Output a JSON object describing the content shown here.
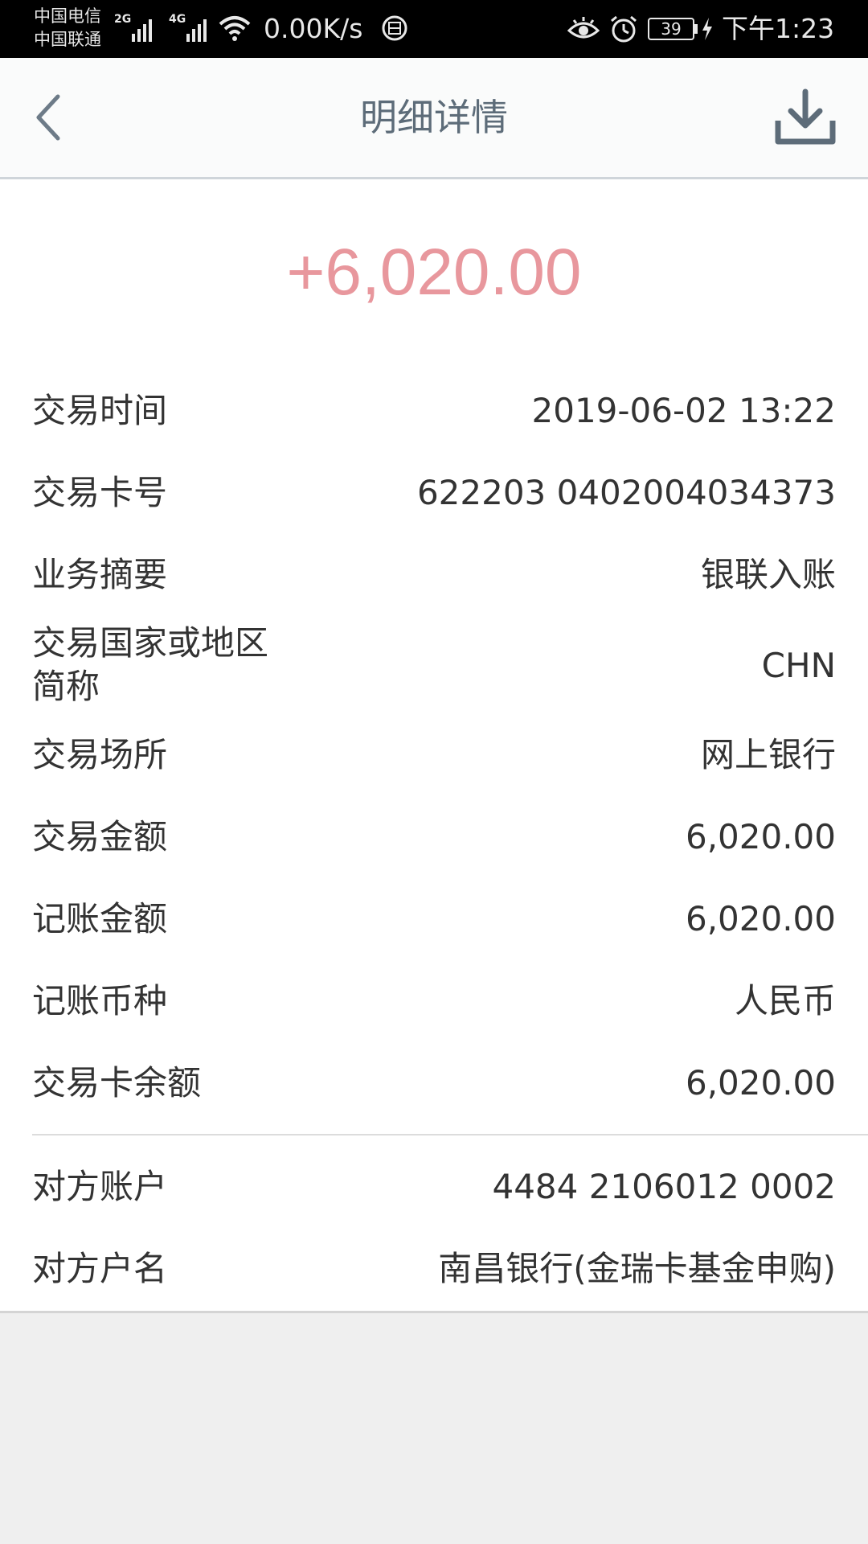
{
  "status_bar": {
    "carrier1": "中国电信",
    "carrier2": "中国联通",
    "net1": "2G",
    "net2": "4G",
    "speed": "0.00K/s",
    "battery": "39",
    "time": "下午1:23"
  },
  "header": {
    "title": "明细详情"
  },
  "detail": {
    "amount": "+6,020.00",
    "rows": [
      {
        "label": "交易时间",
        "value": "2019-06-02 13:22"
      },
      {
        "label": "交易卡号",
        "value": "622203 0402004034373"
      },
      {
        "label": "业务摘要",
        "value": "银联入账"
      },
      {
        "label": "交易国家或地区简称",
        "value": "CHN"
      },
      {
        "label": "交易场所",
        "value": "网上银行"
      },
      {
        "label": "交易金额",
        "value": "6,020.00"
      },
      {
        "label": "记账金额",
        "value": "6,020.00"
      },
      {
        "label": "记账币种",
        "value": "人民币"
      },
      {
        "label": "交易卡余额",
        "value": "6,020.00"
      },
      {
        "label": "对方账户",
        "value": "4484 2106012 0002"
      },
      {
        "label": "对方户名",
        "value": "南昌银行(金瑞卡基金申购)"
      }
    ]
  },
  "colors": {
    "amount": "#e8979d",
    "title": "#5d6c79",
    "text": "#333333",
    "background": "#efefef"
  }
}
